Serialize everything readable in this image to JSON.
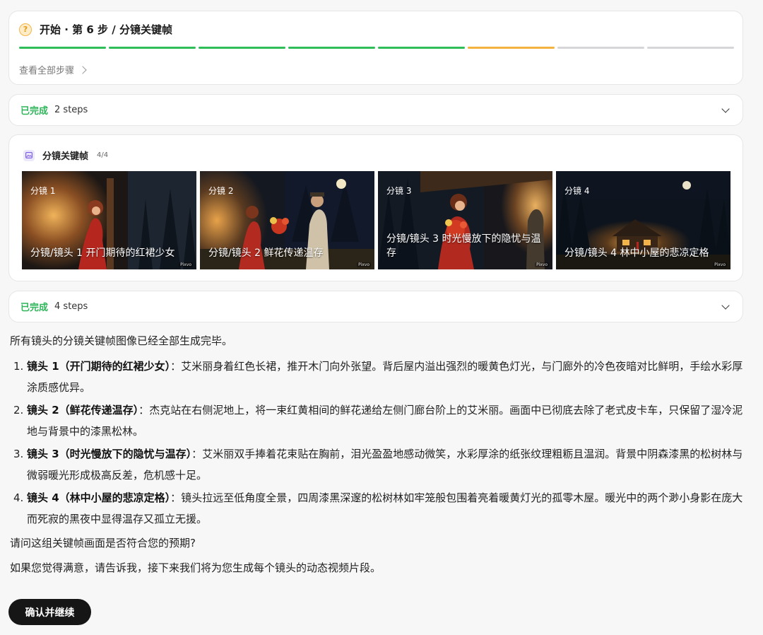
{
  "progress": {
    "title": "开始 · 第 6 步 / 分镜关键帧",
    "total_steps": 8,
    "completed_steps": 5,
    "current_step": 6,
    "view_all_label": "查看全部步骤",
    "colors": {
      "done": "#2ebd59",
      "current": "#f3b33e",
      "pending": "#d6d6d9"
    }
  },
  "done_group_1": {
    "label": "已完成",
    "count": "2 steps"
  },
  "keyframes": {
    "title": "分镜关键帧",
    "count": "4/4",
    "watermark": "Pixvo",
    "shots": [
      {
        "tag": "分镜 1",
        "caption": "分镜/镜头 1 开门期待的红裙少女"
      },
      {
        "tag": "分镜 2",
        "caption": "分镜/镜头 2 鲜花传递温存"
      },
      {
        "tag": "分镜 3",
        "caption": "分镜/镜头 3 时光慢放下的隐忧与温存"
      },
      {
        "tag": "分镜 4",
        "caption": "分镜/镜头 4 林中小屋的悲凉定格"
      }
    ]
  },
  "done_group_2": {
    "label": "已完成",
    "count": "4 steps"
  },
  "message": {
    "intro": "所有镜头的分镜关键帧图像已经全部生成完毕。",
    "items": [
      {
        "num": "1.",
        "title": "镜头 1（开门期待的红裙少女）",
        "sep": "：",
        "text": "艾米丽身着红色长裙，推开木门向外张望。背后屋内溢出强烈的暖黄色灯光，与门廊外的冷色夜暗对比鲜明，手绘水彩厚涂质感优异。"
      },
      {
        "num": "2.",
        "title": "镜头 2（鲜花传递温存）",
        "sep": "：",
        "text": "杰克站在右侧泥地上，将一束红黄相间的鲜花递给左侧门廊台阶上的艾米丽。画面中已彻底去除了老式皮卡车，只保留了湿冷泥地与背景中的漆黑松林。"
      },
      {
        "num": "3.",
        "title": "镜头 3（时光慢放下的隐忧与温存）",
        "sep": "：",
        "text": "艾米丽双手捧着花束贴在胸前，泪光盈盈地感动微笑，水彩厚涂的纸张纹理粗粝且温润。背景中阴森漆黑的松树林与微弱暖光形成极高反差，危机感十足。"
      },
      {
        "num": "4.",
        "title": "镜头 4（林中小屋的悲凉定格）",
        "sep": "：",
        "text": "镜头拉远至低角度全景，四周漆黑深邃的松树林如牢笼般包围着亮着暖黄灯光的孤零木屋。暖光中的两个渺小身影在庞大而死寂的黑夜中显得温存又孤立无援。"
      }
    ],
    "question": "请问这组关键帧画面是否符合您的预期?",
    "followup": "如果您觉得满意，请告诉我，接下来我们将为您生成每个镜头的动态视频片段。"
  },
  "confirm_button": "确认并继续"
}
